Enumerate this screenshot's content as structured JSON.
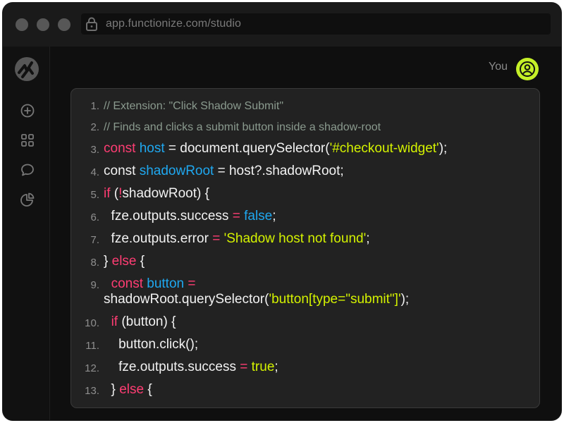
{
  "browser": {
    "url": "app.functionize.com/studio"
  },
  "chat": {
    "sender_label": "You"
  },
  "code": {
    "lines": [
      {
        "num": "1.",
        "parts": [
          [
            "cm",
            "// Extension: \"Click Shadow Submit\""
          ]
        ]
      },
      {
        "num": "2.",
        "parts": [
          [
            "cm",
            "// Finds and clicks a submit button inside a shadow-root"
          ]
        ]
      },
      {
        "num": "3.",
        "parts": [
          [
            "kw",
            "const "
          ],
          [
            "vr",
            "host"
          ],
          [
            "",
            " = document.querySelector("
          ],
          [
            "st",
            "'#checkout-widget'"
          ],
          [
            "",
            ");"
          ]
        ]
      },
      {
        "num": "4.",
        "parts": [
          [
            "",
            "const "
          ],
          [
            "vr",
            "shadowRoot"
          ],
          [
            "",
            " = host?.shadowRoot;"
          ]
        ]
      },
      {
        "num": "5.",
        "parts": [
          [
            "kw",
            "if"
          ],
          [
            "",
            " ("
          ],
          [
            "kw",
            "!"
          ],
          [
            "",
            "shadowRoot) {"
          ]
        ]
      },
      {
        "num": "6.",
        "parts": [
          [
            "",
            "  fze.outputs.success "
          ],
          [
            "op",
            "="
          ],
          [
            "",
            " "
          ],
          [
            "bo",
            "false"
          ],
          [
            "",
            ";"
          ]
        ]
      },
      {
        "num": "7.",
        "parts": [
          [
            "",
            "  fze.outputs.error "
          ],
          [
            "op",
            "="
          ],
          [
            "",
            " "
          ],
          [
            "st",
            "'Shadow host not found'"
          ],
          [
            "",
            ";"
          ]
        ]
      },
      {
        "num": "8.",
        "parts": [
          [
            "",
            "} "
          ],
          [
            "kw",
            "else"
          ],
          [
            "",
            " {"
          ]
        ]
      },
      {
        "num": "9.",
        "parts": [
          [
            "",
            "  "
          ],
          [
            "kw",
            "const "
          ],
          [
            "vr",
            "button"
          ],
          [
            "",
            " "
          ],
          [
            "op",
            "="
          ],
          [
            "",
            "\nshadowRoot.querySelector("
          ],
          [
            "st",
            "'button[type=\"submit\"]'"
          ],
          [
            "",
            ");"
          ]
        ]
      },
      {
        "num": "10.",
        "parts": [
          [
            "",
            "  "
          ],
          [
            "kw",
            "if"
          ],
          [
            "",
            " (button) {"
          ]
        ]
      },
      {
        "num": "11.",
        "parts": [
          [
            "",
            "    button.click();"
          ]
        ]
      },
      {
        "num": "12.",
        "parts": [
          [
            "",
            "    fze.outputs.success "
          ],
          [
            "op",
            "="
          ],
          [
            "",
            " "
          ],
          [
            "tr",
            "true"
          ],
          [
            "",
            ";"
          ]
        ]
      },
      {
        "num": "13.",
        "parts": [
          [
            "",
            "  } "
          ],
          [
            "kw",
            "else"
          ],
          [
            "",
            " {"
          ]
        ]
      }
    ]
  },
  "icons": {
    "lock": "lock-icon",
    "logo": "functionize-logo",
    "new": "plus-circle-icon",
    "grid": "grid-icon",
    "chat": "chat-bubble-icon",
    "analytics": "pie-chart-icon",
    "user": "user-avatar-icon"
  },
  "colors": {
    "accent": "#c5f028",
    "keyword": "#ff3d73",
    "variable": "#1fa8f0",
    "string": "#d4f200",
    "comment": "#8a9a8e"
  }
}
